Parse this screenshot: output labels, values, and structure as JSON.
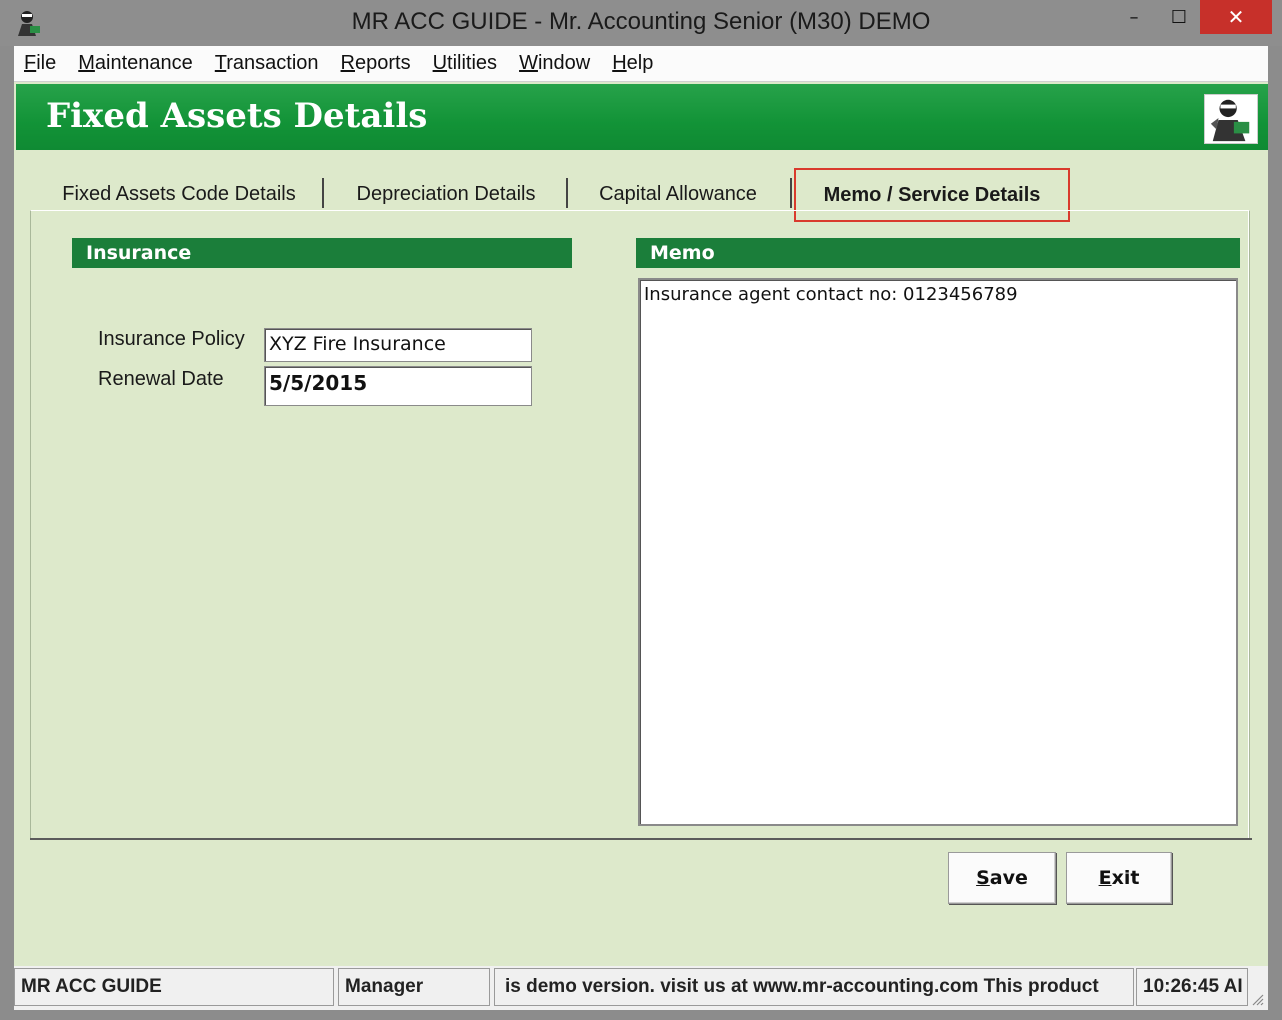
{
  "window": {
    "title": "MR ACC GUIDE - Mr. Accounting Senior (M30) DEMO",
    "minimize": "–",
    "maximize": "☐",
    "close": "✕"
  },
  "menu": [
    {
      "ul": "F",
      "rest": "ile"
    },
    {
      "ul": "M",
      "rest": "aintenance"
    },
    {
      "ul": "T",
      "rest": "ransaction"
    },
    {
      "ul": "R",
      "rest": "eports"
    },
    {
      "ul": "U",
      "rest": "tilities"
    },
    {
      "ul": "W",
      "rest": "indow"
    },
    {
      "ul": "H",
      "rest": "elp"
    }
  ],
  "header": {
    "title": "Fixed Assets Details"
  },
  "tabs": [
    {
      "label": "Fixed Assets Code Details"
    },
    {
      "label": "Depreciation Details"
    },
    {
      "label": "Capital Allowance"
    },
    {
      "label": "Memo / Service Details"
    }
  ],
  "insurance": {
    "section_title": "Insurance",
    "policy_label": "Insurance Policy",
    "policy_value": "XYZ Fire Insurance",
    "renewal_label": "Renewal Date",
    "renewal_value": "5/5/2015"
  },
  "memo": {
    "section_title": "Memo",
    "text": "Insurance agent contact no: 0123456789"
  },
  "buttons": {
    "save": {
      "ul": "S",
      "rest": "ave"
    },
    "exit": {
      "ul": "E",
      "rest": "xit"
    }
  },
  "status": {
    "app": "MR ACC GUIDE",
    "user": "Manager",
    "message": "is demo version.  visit us at www.mr-accounting.com This product",
    "time": "10:26:45 AI"
  },
  "colors": {
    "header_green": "#129337",
    "section_green": "#1b7e3a",
    "panel_bg": "#dde9cb",
    "close_red": "#c7302a",
    "highlight_red": "#d93a2c"
  }
}
